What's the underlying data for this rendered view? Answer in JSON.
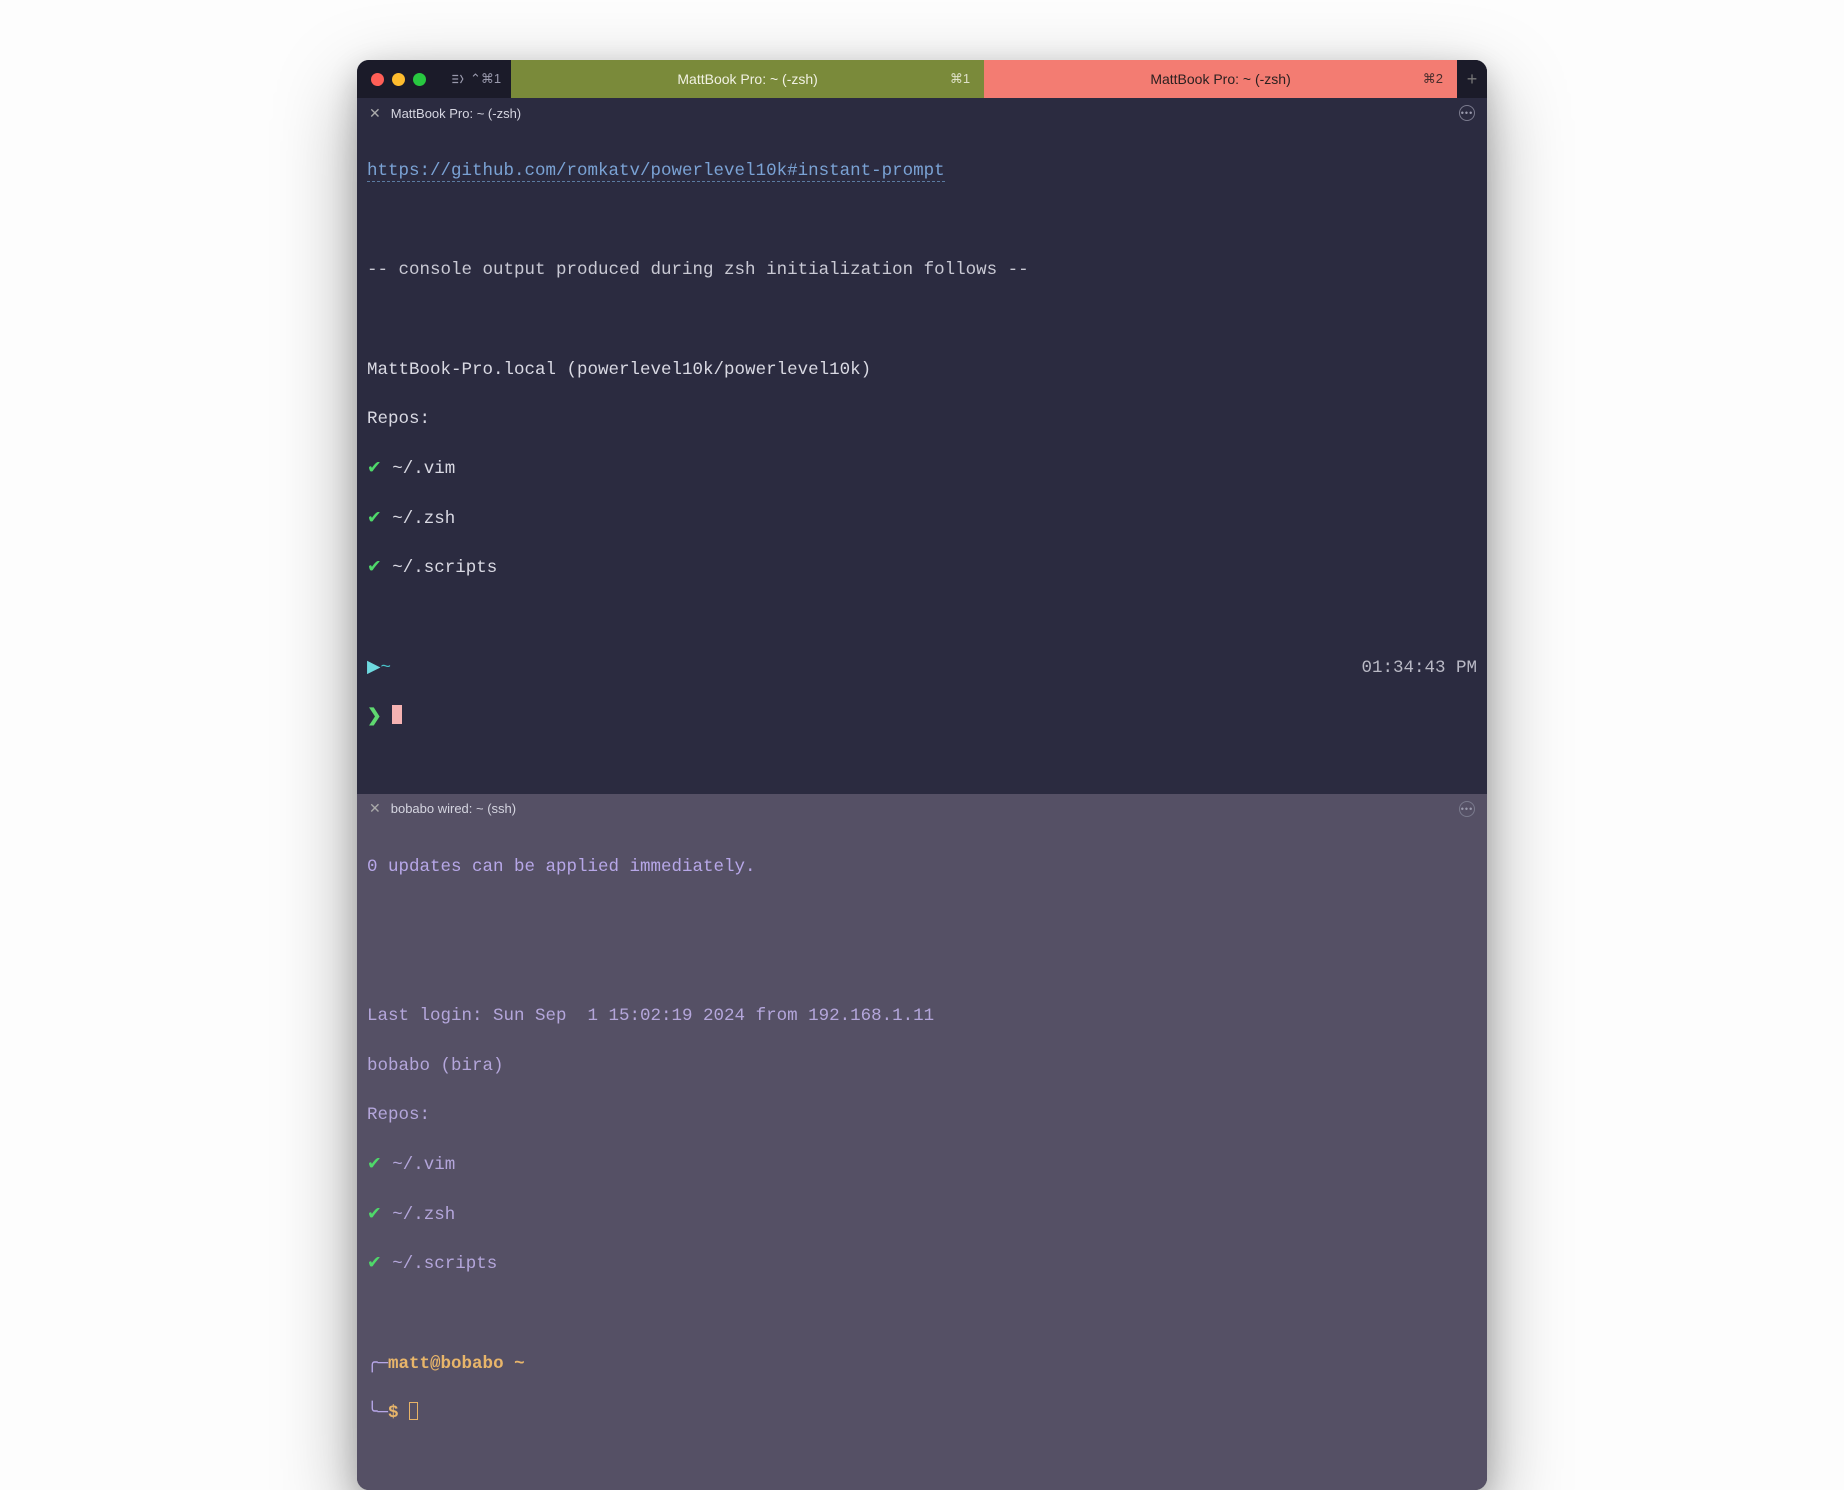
{
  "titlebar": {
    "broadcast_shortcut": "⌃⌘1",
    "tabs": [
      {
        "label": "MattBook Pro: ~ (-zsh)",
        "shortcut": "⌘1"
      },
      {
        "label": "MattBook Pro: ~ (-zsh)",
        "shortcut": "⌘2"
      }
    ],
    "add_label": "+"
  },
  "pane_top": {
    "label": "MattBook Pro: ~ (-zsh)",
    "url": "https://github.com/romkatv/powerlevel10k#instant-prompt",
    "divider": "-- console output produced during zsh initialization follows --",
    "hostline": "MattBook-Pro.local (powerlevel10k/powerlevel10k)",
    "repos_label": "Repos:",
    "repos": [
      "~/.vim",
      "~/.zsh",
      "~/.scripts"
    ],
    "cwd_tilde": "~",
    "prompt_char": "❯",
    "time": "01:34:43 PM"
  },
  "pane_bottom": {
    "label": "bobabo wired: ~ (ssh)",
    "updates_line": "0 updates can be applied immediately.",
    "last_login": "Last login: Sun Sep  1 15:02:19 2024 from 192.168.1.11",
    "hostline": "bobabo (bira)",
    "repos_label": "Repos:",
    "repos": [
      "~/.vim",
      "~/.zsh",
      "~/.scripts"
    ],
    "prompt_top_corner": "╭─",
    "prompt_userhost": "matt@bobabo",
    "prompt_cwd": " ~",
    "prompt_bottom_corner": "╰─",
    "prompt_dollar": "$"
  },
  "check_glyph": "✔"
}
